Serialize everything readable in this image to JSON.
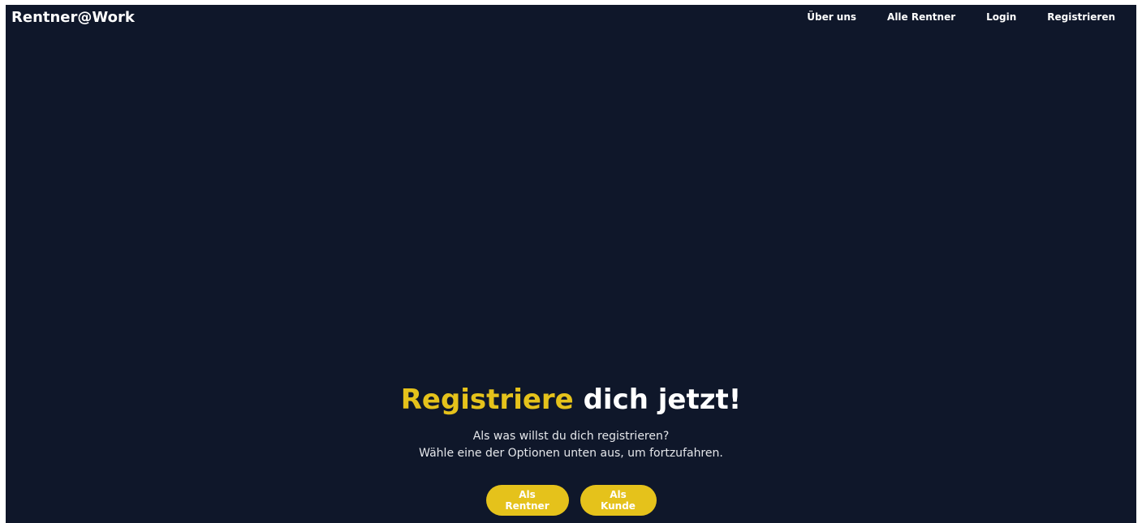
{
  "app": {
    "brand": "Rentner@Work"
  },
  "nav": {
    "items": [
      {
        "label": "Über uns"
      },
      {
        "label": "Alle Rentner"
      },
      {
        "label": "Login"
      },
      {
        "label": "Registrieren"
      }
    ]
  },
  "hero": {
    "headline_accent": "Registriere",
    "headline_rest": "dich jetzt!",
    "line1": "Als was willst du dich registrieren?",
    "line2": "Wähle eine der Optionen unten aus, um fortzufahren.",
    "buttons": {
      "rentner": "Als Rentner",
      "kunde": "Als Kunde"
    }
  },
  "colors": {
    "background": "#0f172a",
    "accent": "#e5c21b",
    "text": "#ffffff"
  }
}
